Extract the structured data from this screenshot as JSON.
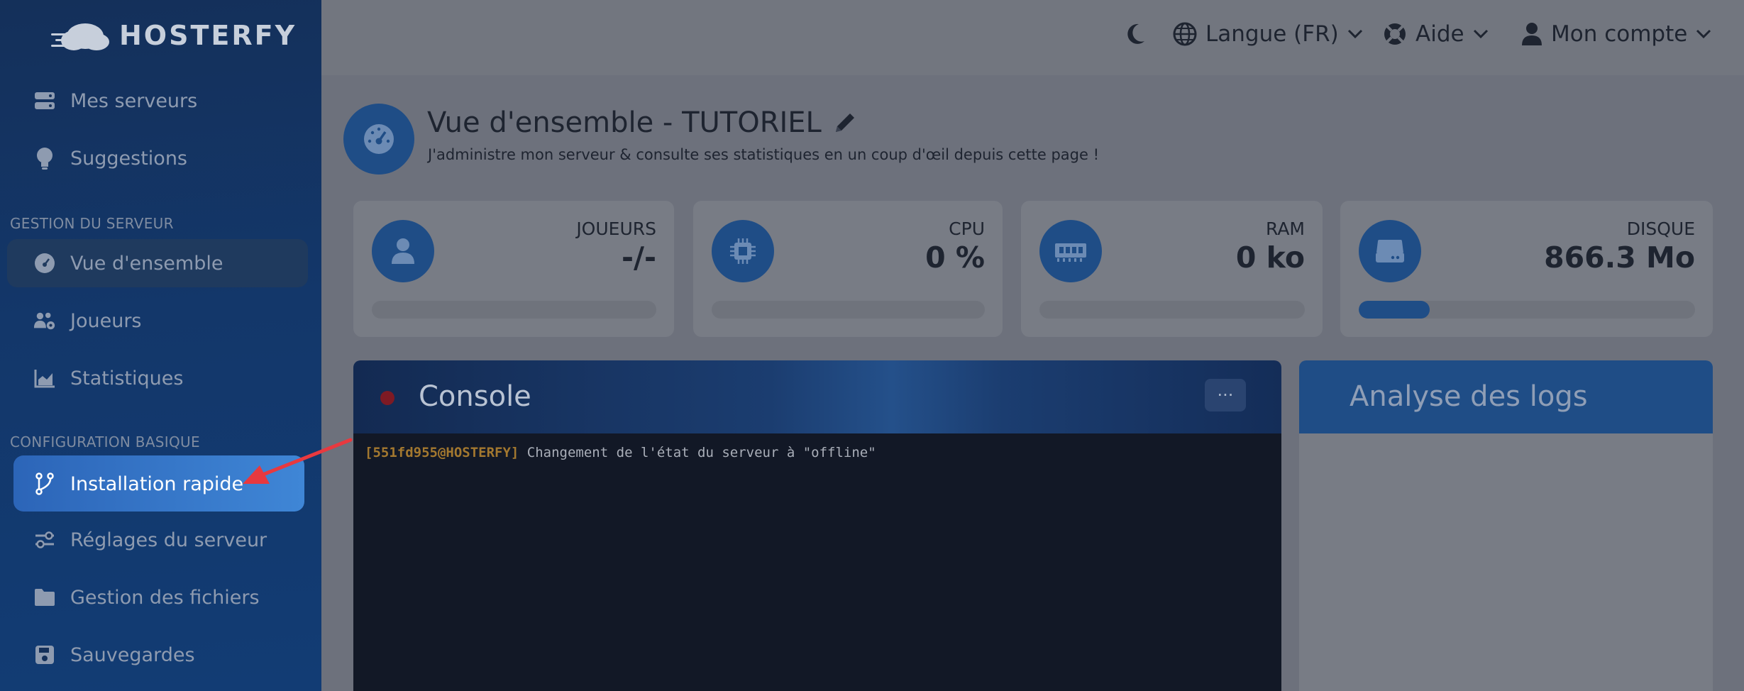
{
  "brand": {
    "name": "HOSTERFY"
  },
  "sidebar": {
    "items_top": [
      {
        "label": "Mes serveurs",
        "icon": "server-icon"
      },
      {
        "label": "Suggestions",
        "icon": "lightbulb-icon"
      }
    ],
    "section_server": "GESTION DU SERVEUR",
    "items_server": [
      {
        "label": "Vue d'ensemble",
        "icon": "dashboard-gauge-icon"
      },
      {
        "label": "Joueurs",
        "icon": "users-gear-icon"
      },
      {
        "label": "Statistiques",
        "icon": "chart-area-icon"
      }
    ],
    "section_config": "CONFIGURATION BASIQUE",
    "items_config": [
      {
        "label": "Installation rapide",
        "icon": "code-branch-icon"
      },
      {
        "label": "Réglages du serveur",
        "icon": "toggle-settings-icon"
      },
      {
        "label": "Gestion des fichiers",
        "icon": "folder-icon"
      },
      {
        "label": "Sauvegardes",
        "icon": "floppy-disk-icon"
      }
    ]
  },
  "topbar": {
    "language": "Langue (FR)",
    "help": "Aide",
    "account": "Mon compte"
  },
  "overview": {
    "title": "Vue d'ensemble - TUTORIEL",
    "subtitle": "J'administre mon serveur & consulte ses statistiques en un coup d'œil depuis cette page !"
  },
  "stats": [
    {
      "label": "JOUEURS",
      "value": "-/-",
      "icon": "user-icon",
      "progress": 0
    },
    {
      "label": "CPU",
      "value": "0 %",
      "icon": "cpu-chip-icon",
      "progress": 0
    },
    {
      "label": "RAM",
      "value": "0 ko",
      "icon": "memory-icon",
      "progress": 0
    },
    {
      "label": "DISQUE",
      "value": "866.3 Mo",
      "icon": "hard-drive-icon",
      "progress": 0.21
    }
  ],
  "console": {
    "title": "Console",
    "menu_glyph": "···",
    "status_color": "#7e1a24",
    "line_prefix": "[551fd955@HOSTERFY]",
    "line_message": "Changement de l'état du serveur à \"offline\""
  },
  "logs": {
    "title": "Analyse des logs"
  },
  "colors": {
    "accent": "#2f6fc4",
    "highlight": "#3f86d6",
    "annotation_arrow": "#e8393f"
  }
}
